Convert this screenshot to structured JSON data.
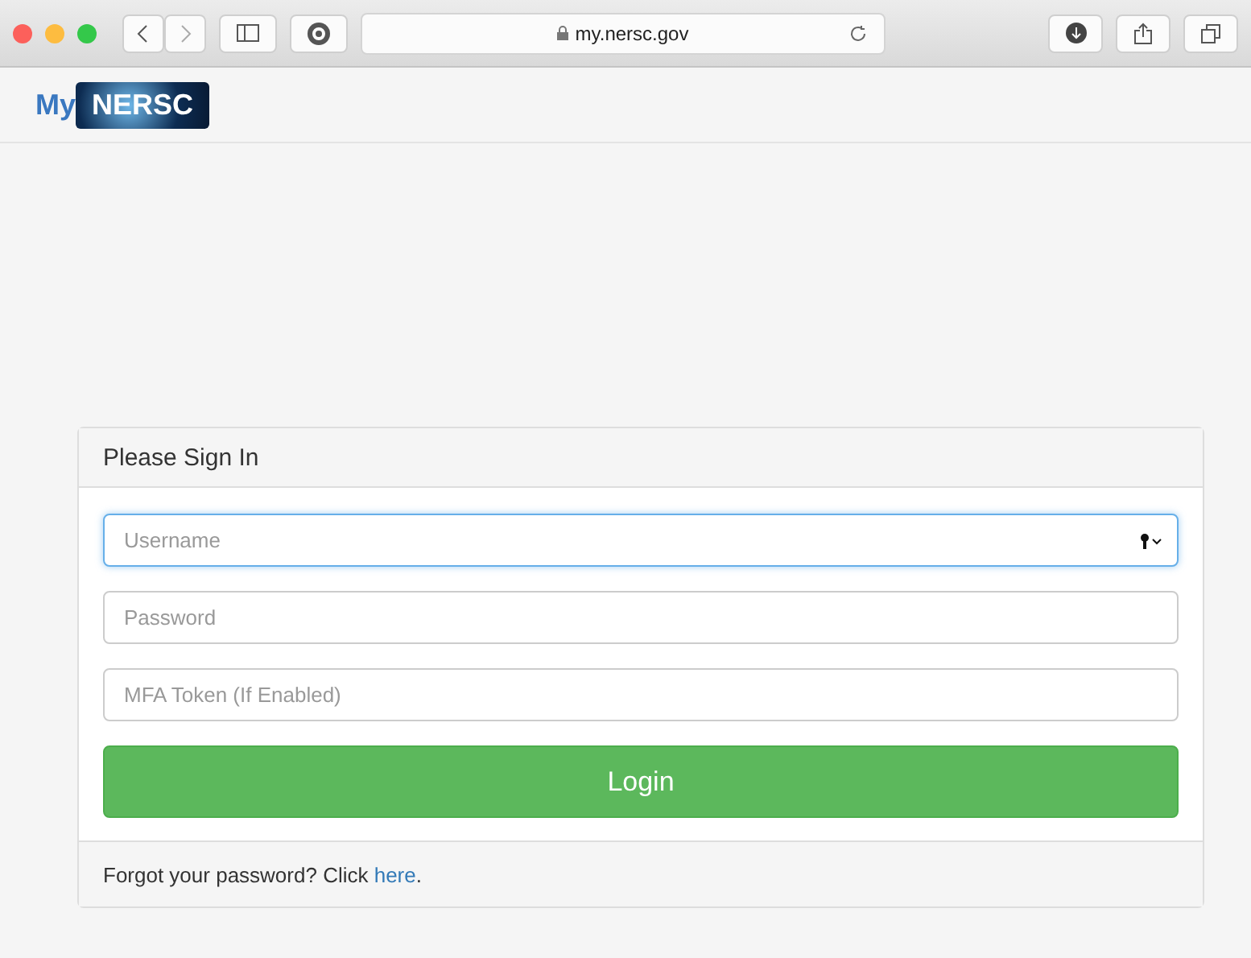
{
  "browser": {
    "address": "my.nersc.gov"
  },
  "logo": {
    "prefix": "My",
    "name": "NERSC"
  },
  "panel": {
    "title": "Please Sign In",
    "fields": [
      {
        "placeholder": "Username",
        "focused": true,
        "key_icon": true
      },
      {
        "placeholder": "Password",
        "focused": false,
        "key_icon": false
      },
      {
        "placeholder": "MFA Token (If Enabled)",
        "focused": false,
        "key_icon": false
      }
    ],
    "button": "Login",
    "footer": {
      "text": "Forgot your password? Click ",
      "link": "here",
      "end": "."
    }
  }
}
